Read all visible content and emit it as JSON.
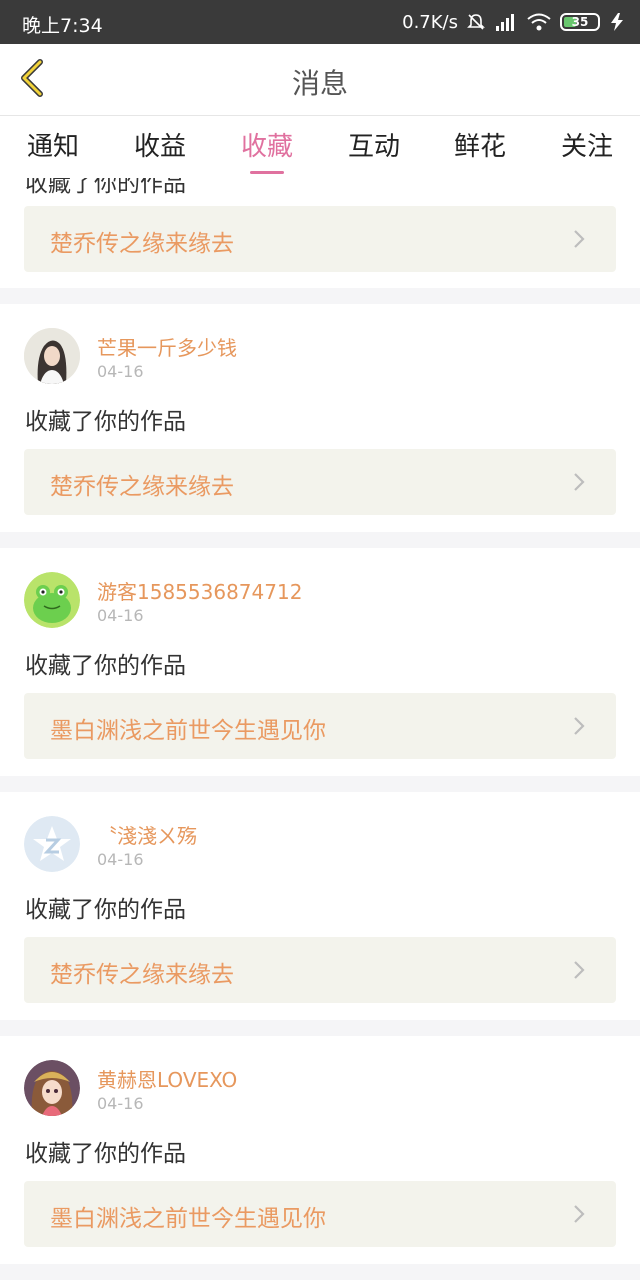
{
  "status_bar": {
    "time": "晚上7:34",
    "speed": "0.7K/s",
    "battery": "35"
  },
  "header": {
    "title": "消息",
    "back_icon": "chevron-left-icon",
    "accent_color": "#e0719f"
  },
  "tabs": [
    {
      "label": "通知"
    },
    {
      "label": "收益"
    },
    {
      "label": "收藏",
      "active": true
    },
    {
      "label": "互动"
    },
    {
      "label": "鲜花"
    },
    {
      "label": "关注"
    }
  ],
  "top_partial": {
    "action": "收藏了你的作品",
    "work_title": "楚乔传之缘来缘去"
  },
  "items": [
    {
      "username": "芒果一斤多少钱",
      "date": "04-16",
      "action": "收藏了你的作品",
      "work_title": "楚乔传之缘来缘去",
      "avatar_icon": "portrait-avatar"
    },
    {
      "username": "游客1585536874712",
      "date": "04-16",
      "action": "收藏了你的作品",
      "work_title": "墨白渊浅之前世今生遇见你",
      "avatar_icon": "frog-avatar"
    },
    {
      "username": "〝淺淺ㄨ殇",
      "date": "04-16",
      "action": "收藏了你的作品",
      "work_title": "楚乔传之缘来缘去",
      "avatar_icon": "default-star-avatar"
    },
    {
      "username": "黄赫恩LOVEXO",
      "date": "04-16",
      "action": "收藏了你的作品",
      "work_title": "墨白渊浅之前世今生遇见你",
      "avatar_icon": "anime-girl-avatar"
    }
  ]
}
